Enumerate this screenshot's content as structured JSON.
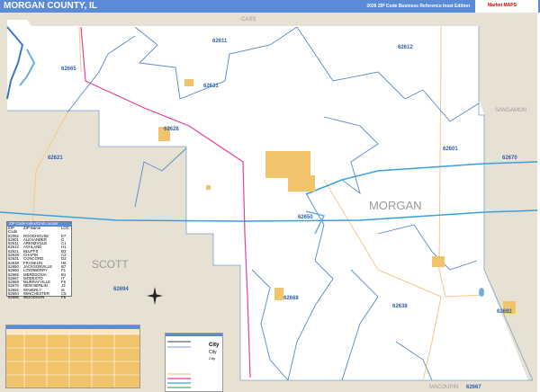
{
  "header": {
    "title": "MORGAN COUNTY, IL",
    "edition": "2026 ZIP Code Business Reference Inset Edition",
    "logo": "Market MAPS"
  },
  "counties": {
    "main": "MORGAN",
    "neighbors": [
      "CASS",
      "SANGAMON",
      "SCOTT",
      "MACOUPIN"
    ]
  },
  "zip_labels": [
    "62611",
    "62612",
    "62665",
    "62631",
    "62628",
    "62621",
    "62601",
    "62670",
    "62650",
    "62694",
    "62668",
    "62638",
    "62692",
    "62667"
  ],
  "zip_index": {
    "title": "ZIP Code Index/Grid Locator",
    "columns": [
      "ZIP Code",
      "ZIP Name",
      "LOC"
    ],
    "rows": [
      [
        "62082",
        "ROODHOUSE",
        "E7"
      ],
      [
        "62601",
        "ALEXANDER",
        "G"
      ],
      [
        "62611",
        "ARENZVILLE",
        "C1"
      ],
      [
        "62612",
        "ASHLAND",
        "H1"
      ],
      [
        "62621",
        "BLUFFS",
        "B3"
      ],
      [
        "62628",
        "CHAPIN",
        "C2"
      ],
      [
        "62631",
        "CONCORD",
        "D2"
      ],
      [
        "62638",
        "FRANKLIN",
        "H6"
      ],
      [
        "62650",
        "JACKSONVILLE",
        "B7"
      ],
      [
        "62660",
        "LITERBERRY",
        "F1"
      ],
      [
        "62665",
        "MEREDOSIA",
        "B1"
      ],
      [
        "62667",
        "MODESTO",
        "I7"
      ],
      [
        "62668",
        "MURRAYVILLE",
        "F6"
      ],
      [
        "62670",
        "NEW BERLIN",
        "J3"
      ],
      [
        "62692",
        "WAVERLY",
        "I6"
      ],
      [
        "62694",
        "WINCHESTER",
        "C5"
      ],
      [
        "62695",
        "WOODSON",
        "F5"
      ]
    ]
  },
  "legend": {
    "city_labels": [
      "City",
      "City",
      "City"
    ]
  },
  "colors": {
    "header": "#5b8ad6",
    "neighbor": "#e6e1d3",
    "city": "#f1c36a",
    "zip_line": "#5a88c8",
    "highway": "#3aa0e0",
    "interstate": "#e6409a",
    "road": "#f4c98a"
  }
}
